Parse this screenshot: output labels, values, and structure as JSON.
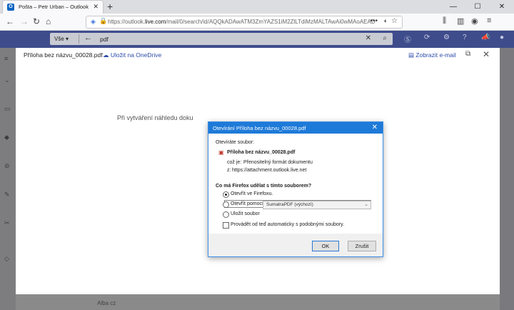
{
  "browser": {
    "tab_title": "Pošta – Petr Urban – Outlook",
    "tab_favicon": "O",
    "url_prefix": "https://outlook.",
    "url_domain": "live.com",
    "url_rest": "/mail/0/search/id/AQQkADAwATM3ZmYAZS1iM2ZlLTdiMzMALTAwAi0wMAoAEADuni..."
  },
  "outlook": {
    "search_scope": "Vše",
    "search_query": "pdf",
    "bottom_text": "Alba cz"
  },
  "preview": {
    "attachment_name": "Příloha bez názvu_00028.pdf",
    "save_onedrive": "Uložit na OneDrive",
    "view_email": "Zobrazit e-mail",
    "loading_message": "Při vytváření náhledu doku"
  },
  "dialog": {
    "title": "Otevírání Příloha bez názvu_00028.pdf",
    "opening_label": "Otevíráte soubor:",
    "file_name": "Příloha bez názvu_00028.pdf",
    "type_label": "což je:",
    "type_value": "Přenositelný formát dokumentu",
    "from_label": "z:",
    "from_value": "https://attachment.outlook.live.net",
    "question": "Co má Firefox udělat s tímto souborem?",
    "option_open_firefox": "Otevřít ve Firefoxu.",
    "option_open_with": "Otevřít pomocí",
    "option_open_with_app": "SumatraPDF (výchozí)",
    "option_save": "Uložit soubor",
    "remember_label": "Provádět od teď automaticky s podobnými soubory.",
    "ok_label": "OK",
    "cancel_label": "Zrušit"
  },
  "colors": {
    "dialog_title_bar": "#1e7ad8",
    "outlook_bar": "#3e4c8c",
    "link": "#2b4ba8"
  }
}
